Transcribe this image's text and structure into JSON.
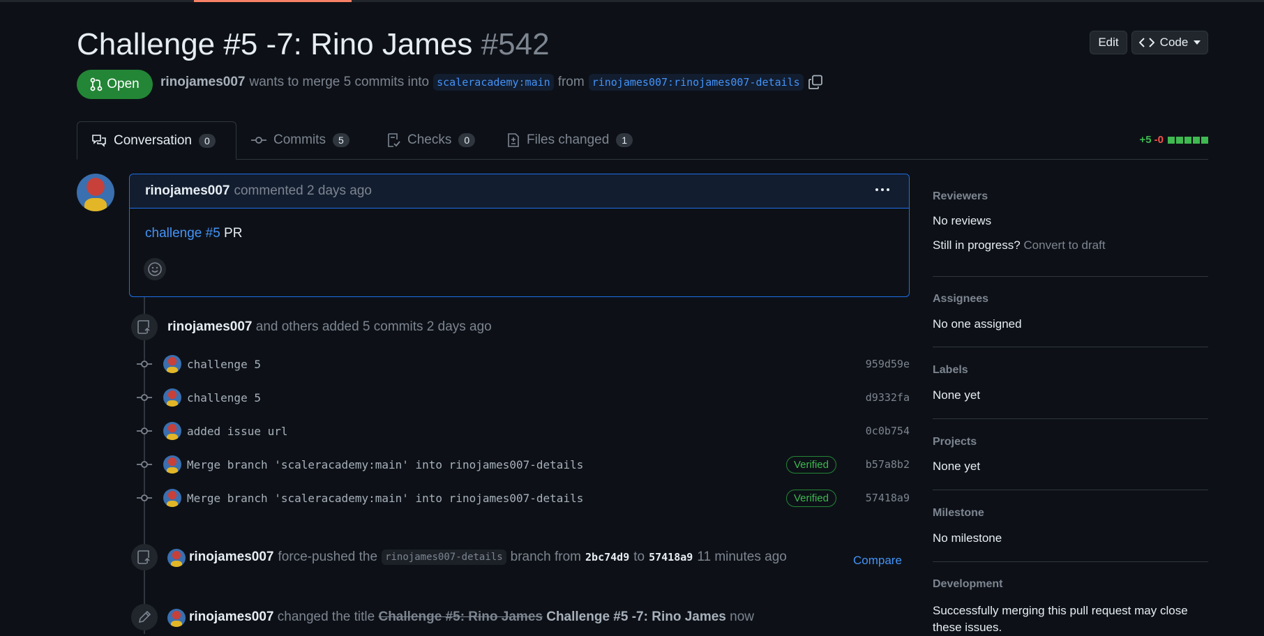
{
  "pr": {
    "title": "Challenge #5 -7: Rino James",
    "number": "#542",
    "state": "Open",
    "author": "rinojames007",
    "merge_text": "wants to merge 5 commits into",
    "base_branch": "scaleracademy:main",
    "from_text": "from",
    "head_branch": "rinojames007:rinojames007-details"
  },
  "header": {
    "edit_label": "Edit",
    "code_label": "Code"
  },
  "tabs": [
    {
      "label": "Conversation",
      "count": "0"
    },
    {
      "label": "Commits",
      "count": "5"
    },
    {
      "label": "Checks",
      "count": "0"
    },
    {
      "label": "Files changed",
      "count": "1"
    }
  ],
  "diffstat": {
    "additions": "+5",
    "deletions": "-0"
  },
  "comment": {
    "author": "rinojames007",
    "action": "commented",
    "time": "2 days ago",
    "body_link": "challenge #5",
    "body_text": "PR"
  },
  "commits_event": {
    "author": "rinojames007",
    "text": "and others added 5 commits",
    "time": "2 days ago"
  },
  "commits": [
    {
      "message": "challenge 5",
      "sha": "959d59e",
      "verified": ""
    },
    {
      "message": "challenge 5",
      "sha": "d9332fa",
      "verified": ""
    },
    {
      "message": "added issue url",
      "sha": "0c0b754",
      "verified": ""
    },
    {
      "message": "Merge branch 'scaleracademy:main' into rinojames007-details",
      "sha": "b57a8b2",
      "verified": "Verified"
    },
    {
      "message": "Merge branch 'scaleracademy:main' into rinojames007-details",
      "sha": "57418a9",
      "verified": "Verified"
    }
  ],
  "force_push": {
    "author": "rinojames007",
    "text1": "force-pushed the",
    "branch": "rinojames007-details",
    "text2": "branch from",
    "from_sha": "2bc74d9",
    "text3": "to",
    "to_sha": "57418a9",
    "time": "11 minutes ago",
    "compare": "Compare"
  },
  "rename": {
    "author": "rinojames007",
    "text": "changed the title",
    "old_title": "Challenge #5: Rino James",
    "new_title": "Challenge #5 -7: Rino James",
    "time": "now"
  },
  "sidebar": {
    "reviewers": {
      "title": "Reviewers",
      "value": "No reviews",
      "draft_q": "Still in progress?",
      "draft_link": "Convert to draft"
    },
    "assignees": {
      "title": "Assignees",
      "value": "No one assigned"
    },
    "labels": {
      "title": "Labels",
      "value": "None yet"
    },
    "projects": {
      "title": "Projects",
      "value": "None yet"
    },
    "milestone": {
      "title": "Milestone",
      "value": "No milestone"
    },
    "development": {
      "title": "Development",
      "value": "Successfully merging this pull request may close these issues."
    }
  },
  "colors": {
    "accent": "#1f6feb",
    "open_green": "#238636",
    "link": "#4493f8",
    "added": "#3fb950",
    "deleted": "#f85149"
  }
}
